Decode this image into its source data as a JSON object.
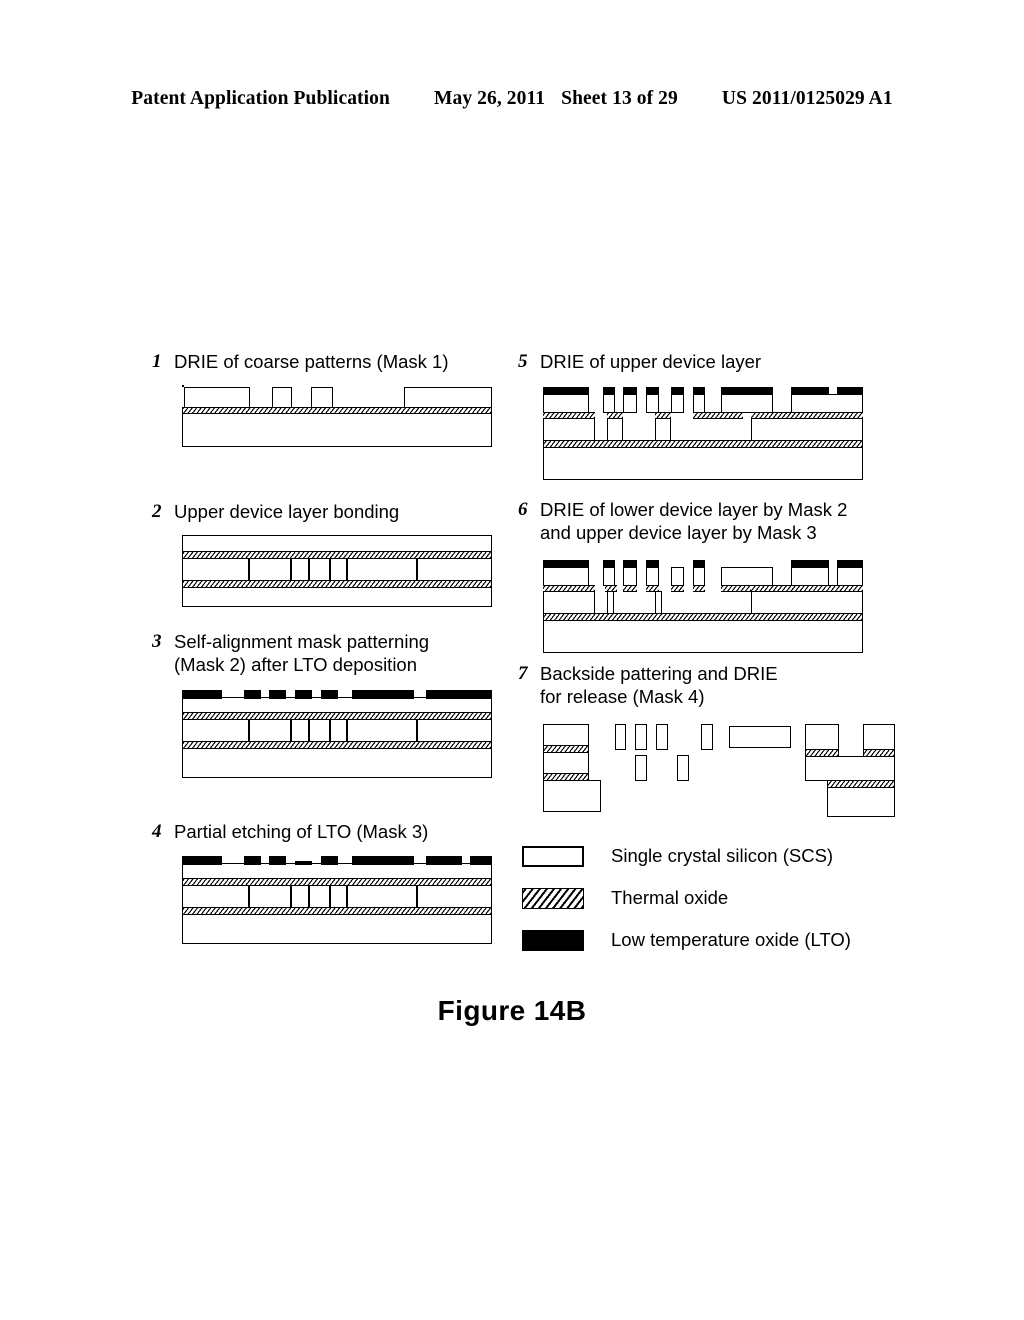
{
  "header": {
    "publication": "Patent Application Publication",
    "date": "May 26, 2011",
    "sheet": "Sheet 13 of 29",
    "number": "US 2011/0125029 A1"
  },
  "figure": {
    "caption": "Figure 14B"
  },
  "steps": [
    {
      "number": "1",
      "label": "DRIE of coarse patterns (Mask 1)",
      "column": "left"
    },
    {
      "number": "2",
      "label": "Upper device layer bonding",
      "column": "left"
    },
    {
      "number": "3",
      "label": "Self-alignment mask patterning\n(Mask 2) after LTO deposition",
      "column": "left"
    },
    {
      "number": "4",
      "label": "Partial etching of LTO (Mask 3)",
      "column": "left"
    },
    {
      "number": "5",
      "label": "DRIE of upper device layer",
      "column": "right"
    },
    {
      "number": "6",
      "label": "DRIE of lower device layer by Mask 2\nand upper device layer by Mask 3",
      "column": "right"
    },
    {
      "number": "7",
      "label": "Backside pattering and DRIE\n for release (Mask 4)",
      "column": "right"
    }
  ],
  "legend": {
    "items": [
      {
        "swatch": "scs-swatch",
        "label": "Single crystal silicon (SCS)"
      },
      {
        "swatch": "thermal-oxide-swatch",
        "label": "Thermal oxide"
      },
      {
        "swatch": "lto-swatch",
        "label": "Low temperature oxide (LTO)"
      }
    ]
  },
  "materials": {
    "scs": {
      "name": "Single crystal silicon (SCS)",
      "fill": "#ffffff",
      "stroke": "#000000"
    },
    "thermal_oxide": {
      "name": "Thermal oxide",
      "fill": "hatched",
      "stroke": "#000000"
    },
    "lto": {
      "name": "Low temperature oxide (LTO)",
      "fill": "#000000",
      "stroke": "#000000"
    }
  }
}
